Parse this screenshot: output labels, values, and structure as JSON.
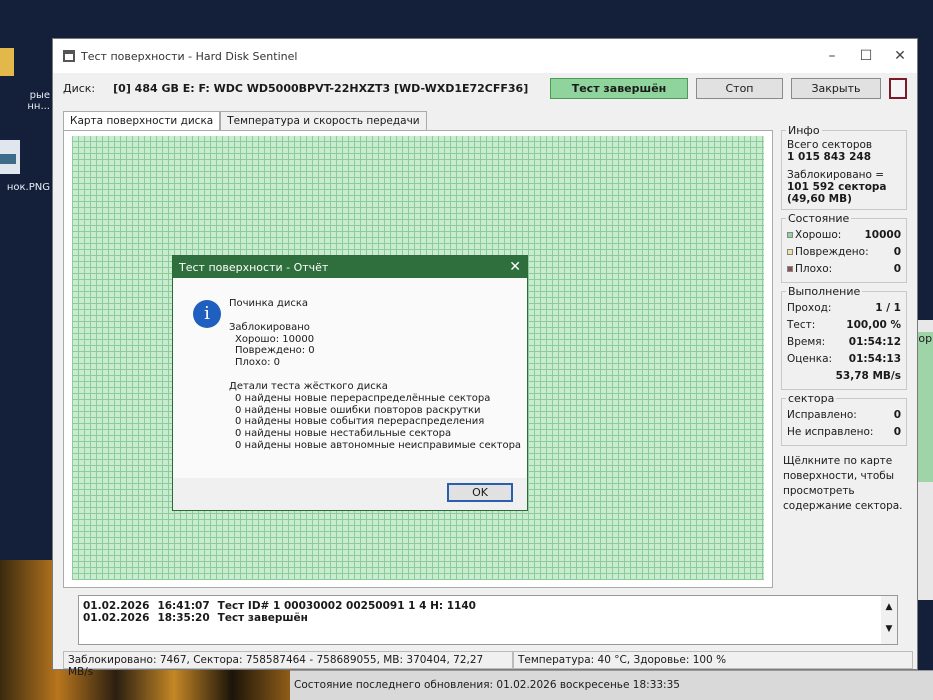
{
  "desktop": {
    "icon1_label": "рые\nнн...",
    "icon2_label": "нок.PNG",
    "back_window_text": "тор",
    "back_status": "Состояние последнего обновления: 01.02.2026 воскресенье 18:33:35"
  },
  "window": {
    "title": "Тест поверхности - Hard Disk Sentinel",
    "minimize": "–",
    "maximize": "☐",
    "close": "✕"
  },
  "toolbar": {
    "disk_label": "Диск:",
    "disk_value": "[0] 484 GB E: F: WDC WD5000BPVT-22HXZT3 [WD-WXD1E72CFF36]",
    "done_button": "Тест завершён",
    "stop_button": "Стоп",
    "close_button": "Закрыть"
  },
  "tabs": [
    {
      "label": "Карта поверхности диска"
    },
    {
      "label": "Температура и скорость передачи"
    }
  ],
  "info": {
    "title": "Инфо",
    "total_label": "Всего секторов",
    "total_value": "1 015 843 248",
    "blocked_label": "Заблокировано =",
    "blocked_value": "101 592 сектора",
    "blocked_size": "(49,60 MB)"
  },
  "state": {
    "title": "Состояние",
    "good_label": "Хорошо:",
    "good_value": "10000",
    "damaged_label": "Повреждено:",
    "damaged_value": "0",
    "bad_label": "Плохо:",
    "bad_value": "0",
    "colors": {
      "good": "#8fd49c",
      "damaged": "#f3e0a0",
      "bad": "#8a5050"
    }
  },
  "progress": {
    "title": "Выполнение",
    "pass_label": "Проход:",
    "pass_value": "1 / 1",
    "test_label": "Тест:",
    "test_value": "100,00 %",
    "time_label": "Время:",
    "time_value": "01:54:12",
    "estimate_label": "Оценка:",
    "estimate_value": "01:54:13",
    "speed": "53,78 MB/s"
  },
  "sectors": {
    "title": "сектора",
    "fixed_label": "Исправлено:",
    "fixed_value": "0",
    "unfixed_label": "Не исправлено:",
    "unfixed_value": "0"
  },
  "hint": "Щёлкните по карте поверхности, чтобы просмотреть содержание сектора.",
  "log": [
    {
      "date": "01.02.2026",
      "time": "16:41:07",
      "text": "Тест ID# 1 00030002 00250091 1 4 H: 1140"
    },
    {
      "date": "01.02.2026",
      "time": "18:35:20",
      "text": "Тест завершён"
    }
  ],
  "statusbar": {
    "left": "Заблокировано: 7467, Сектора: 758587464 - 758689055, MB: 370404, 72,27 MB/s",
    "right": "Температура: 40  °C,  Здоровье: 100 %"
  },
  "dialog": {
    "title": "Тест поверхности - Отчёт",
    "heading": "Починка диска",
    "blocked": "Заблокировано",
    "good": "Хорошо: 10000",
    "damaged": "Повреждено: 0",
    "bad": "Плохо: 0",
    "details_title": "Детали теста жёсткого диска",
    "details": [
      "0 найдены новые перераспределённые сектора",
      "0 найдены новые ошибки повторов раскрутки",
      "0 найдены новые события перераспределения",
      "0 найдены новые нестабильные сектора",
      "0 найдены новые автономные неисправимые сектора"
    ],
    "ok": "OK"
  }
}
